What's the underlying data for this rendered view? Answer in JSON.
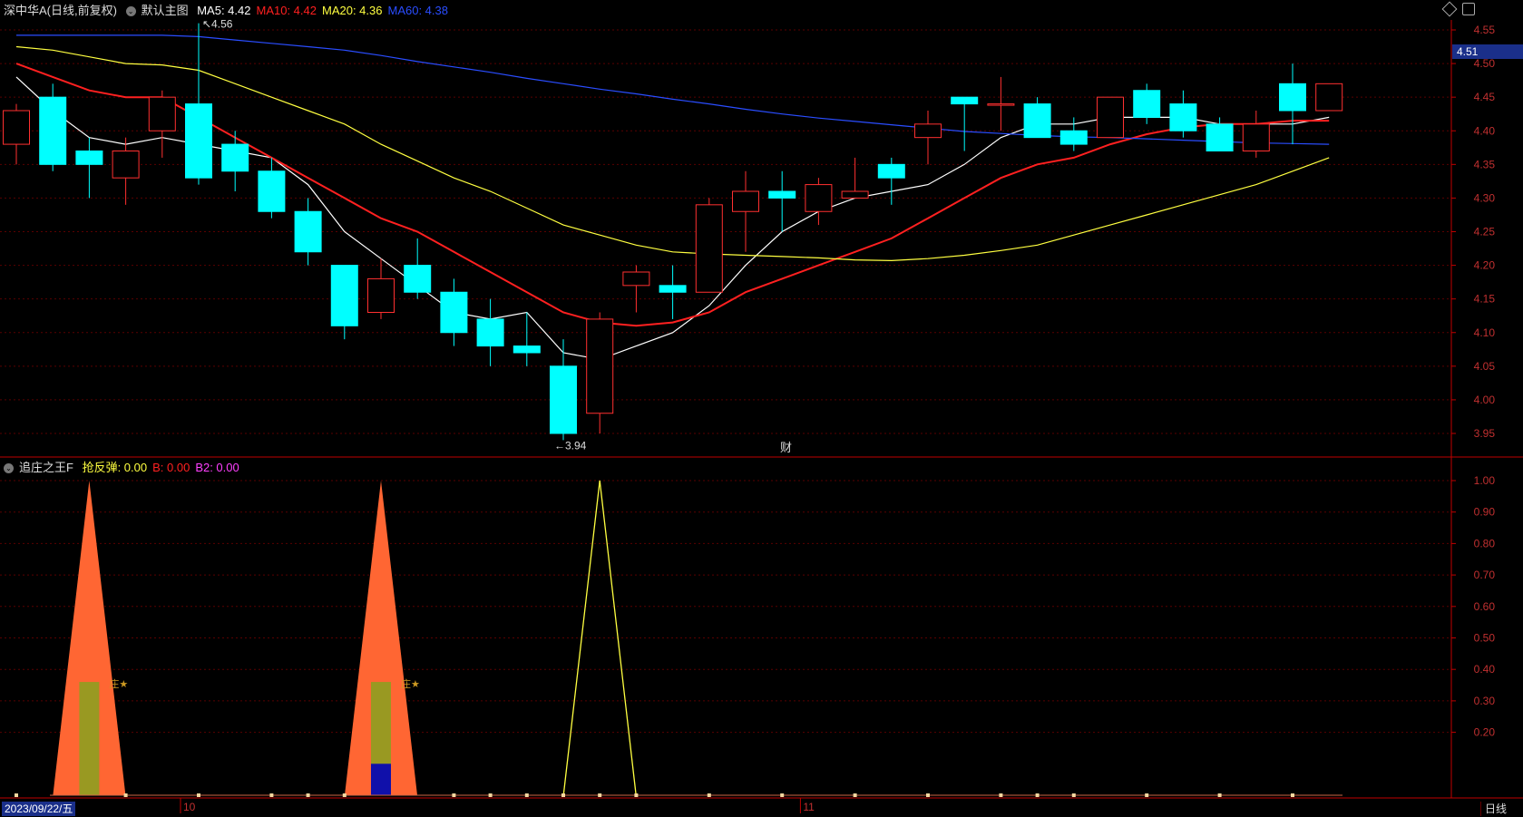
{
  "main_header": {
    "symbol": "深中华A",
    "mode": "(日线,前复权)",
    "template": "默认主图",
    "ma": [
      {
        "label": "MA5:",
        "value": "4.42",
        "color": "#ffffff"
      },
      {
        "label": "MA10:",
        "value": "4.42",
        "color": "#ff2020"
      },
      {
        "label": "MA20:",
        "value": "4.36",
        "color": "#ffff40"
      },
      {
        "label": "MA60:",
        "value": "4.38",
        "color": "#2a4dff"
      }
    ]
  },
  "indicator_header": {
    "name": "追庄之王F",
    "items": [
      {
        "label": "抢反弹:",
        "value": "0.00",
        "color": "#ffff40"
      },
      {
        "label": "B:",
        "value": "0.00",
        "color": "#ff2020"
      },
      {
        "label": "B2:",
        "value": "0.00",
        "color": "#ff40ff"
      }
    ]
  },
  "bottom_bar": {
    "date": "2023/09/22/五",
    "month_labels": [
      {
        "text": "10",
        "index": 5
      },
      {
        "text": "11",
        "index": 22
      }
    ],
    "period_button": "日线"
  },
  "annotations": {
    "high_label": "4.56",
    "low_label": "3.94",
    "finance_marker": "财",
    "current_price": "4.51",
    "star_label": "庄★"
  },
  "toolbar_icons": [
    "diamond-icon",
    "settings-icon"
  ],
  "colors": {
    "up": "#ff3030",
    "down": "#00ffff",
    "grid": "#5a0000",
    "axis": "#c00000",
    "orange_fill": "#ff6633",
    "olive_bar": "#999922",
    "blue_bar": "#1010aa",
    "yellow_line": "#ffff40"
  },
  "chart_data": [
    {
      "type": "candlestick",
      "y_ticks": [
        "4.55",
        "4.50",
        "4.45",
        "4.40",
        "4.35",
        "4.30",
        "4.25",
        "4.20",
        "4.15",
        "4.10",
        "4.05",
        "4.00",
        "3.95"
      ],
      "ylim": [
        3.92,
        4.57
      ],
      "candles": [
        {
          "o": 4.38,
          "h": 4.44,
          "l": 4.35,
          "c": 4.43
        },
        {
          "o": 4.45,
          "h": 4.47,
          "l": 4.34,
          "c": 4.35
        },
        {
          "o": 4.37,
          "h": 4.39,
          "l": 4.3,
          "c": 4.35
        },
        {
          "o": 4.33,
          "h": 4.39,
          "l": 4.29,
          "c": 4.37
        },
        {
          "o": 4.4,
          "h": 4.46,
          "l": 4.36,
          "c": 4.45
        },
        {
          "o": 4.44,
          "h": 4.56,
          "l": 4.32,
          "c": 4.33
        },
        {
          "o": 4.38,
          "h": 4.4,
          "l": 4.31,
          "c": 4.34
        },
        {
          "o": 4.34,
          "h": 4.36,
          "l": 4.27,
          "c": 4.28
        },
        {
          "o": 4.28,
          "h": 4.3,
          "l": 4.2,
          "c": 4.22
        },
        {
          "o": 4.2,
          "h": 4.2,
          "l": 4.09,
          "c": 4.11
        },
        {
          "o": 4.13,
          "h": 4.21,
          "l": 4.12,
          "c": 4.18
        },
        {
          "o": 4.2,
          "h": 4.24,
          "l": 4.15,
          "c": 4.16
        },
        {
          "o": 4.16,
          "h": 4.18,
          "l": 4.08,
          "c": 4.1
        },
        {
          "o": 4.12,
          "h": 4.15,
          "l": 4.05,
          "c": 4.08
        },
        {
          "o": 4.08,
          "h": 4.13,
          "l": 4.05,
          "c": 4.07
        },
        {
          "o": 4.05,
          "h": 4.09,
          "l": 3.94,
          "c": 3.95
        },
        {
          "o": 3.98,
          "h": 4.13,
          "l": 3.95,
          "c": 4.12
        },
        {
          "o": 4.17,
          "h": 4.2,
          "l": 4.13,
          "c": 4.19
        },
        {
          "o": 4.17,
          "h": 4.2,
          "l": 4.12,
          "c": 4.16
        },
        {
          "o": 4.16,
          "h": 4.3,
          "l": 4.16,
          "c": 4.29
        },
        {
          "o": 4.28,
          "h": 4.34,
          "l": 4.22,
          "c": 4.31
        },
        {
          "o": 4.31,
          "h": 4.34,
          "l": 4.25,
          "c": 4.3
        },
        {
          "o": 4.28,
          "h": 4.33,
          "l": 4.26,
          "c": 4.32
        },
        {
          "o": 4.3,
          "h": 4.36,
          "l": 4.3,
          "c": 4.31
        },
        {
          "o": 4.35,
          "h": 4.36,
          "l": 4.29,
          "c": 4.33
        },
        {
          "o": 4.39,
          "h": 4.43,
          "l": 4.35,
          "c": 4.41
        },
        {
          "o": 4.45,
          "h": 4.45,
          "l": 4.37,
          "c": 4.44
        },
        {
          "o": 4.44,
          "h": 4.48,
          "l": 4.4,
          "c": 4.44
        },
        {
          "o": 4.44,
          "h": 4.45,
          "l": 4.39,
          "c": 4.39
        },
        {
          "o": 4.4,
          "h": 4.42,
          "l": 4.37,
          "c": 4.38
        },
        {
          "o": 4.39,
          "h": 4.45,
          "l": 4.39,
          "c": 4.45
        },
        {
          "o": 4.46,
          "h": 4.47,
          "l": 4.41,
          "c": 4.42
        },
        {
          "o": 4.44,
          "h": 4.46,
          "l": 4.39,
          "c": 4.4
        },
        {
          "o": 4.41,
          "h": 4.42,
          "l": 4.37,
          "c": 4.37
        },
        {
          "o": 4.37,
          "h": 4.43,
          "l": 4.36,
          "c": 4.41
        },
        {
          "o": 4.47,
          "h": 4.5,
          "l": 4.38,
          "c": 4.43
        },
        {
          "o": 4.43,
          "h": 4.47,
          "l": 4.43,
          "c": 4.47
        }
      ],
      "series": [
        {
          "name": "MA5",
          "color": "#ffffff",
          "values": [
            4.48,
            4.43,
            4.39,
            4.38,
            4.39,
            4.38,
            4.37,
            4.36,
            4.32,
            4.25,
            4.21,
            4.17,
            4.13,
            4.12,
            4.13,
            4.07,
            4.06,
            4.08,
            4.1,
            4.14,
            4.2,
            4.25,
            4.28,
            4.3,
            4.31,
            4.32,
            4.35,
            4.39,
            4.41,
            4.41,
            4.42,
            4.42,
            4.42,
            4.41,
            4.41,
            4.41,
            4.42
          ]
        },
        {
          "name": "MA10",
          "color": "#ff2020",
          "values": [
            4.5,
            4.48,
            4.46,
            4.45,
            4.45,
            4.42,
            4.39,
            4.36,
            4.33,
            4.3,
            4.27,
            4.25,
            4.22,
            4.19,
            4.16,
            4.13,
            4.115,
            4.11,
            4.115,
            4.13,
            4.16,
            4.18,
            4.2,
            4.22,
            4.24,
            4.27,
            4.3,
            4.33,
            4.35,
            4.36,
            4.38,
            4.395,
            4.405,
            4.41,
            4.41,
            4.415,
            4.415
          ]
        },
        {
          "name": "MA20",
          "color": "#ffff40",
          "values": [
            4.525,
            4.52,
            4.51,
            4.5,
            4.498,
            4.49,
            4.47,
            4.45,
            4.43,
            4.41,
            4.38,
            4.355,
            4.33,
            4.31,
            4.285,
            4.26,
            4.245,
            4.23,
            4.22,
            4.217,
            4.215,
            4.213,
            4.211,
            4.208,
            4.207,
            4.21,
            4.215,
            4.222,
            4.23,
            4.245,
            4.26,
            4.275,
            4.29,
            4.305,
            4.32,
            4.34,
            4.36
          ]
        },
        {
          "name": "MA60",
          "color": "#2a4dff",
          "values": [
            4.542,
            4.542,
            4.542,
            4.542,
            4.542,
            4.54,
            4.535,
            4.53,
            4.525,
            4.52,
            4.512,
            4.503,
            4.495,
            4.487,
            4.478,
            4.47,
            4.462,
            4.455,
            4.447,
            4.44,
            4.432,
            4.425,
            4.419,
            4.414,
            4.409,
            4.404,
            4.399,
            4.396,
            4.393,
            4.391,
            4.39,
            4.388,
            4.386,
            4.384,
            4.382,
            4.381,
            4.38
          ]
        }
      ]
    },
    {
      "type": "indicator",
      "name": "追庄之王F",
      "y_ticks": [
        "1.00",
        "0.90",
        "0.80",
        "0.70",
        "0.60",
        "0.50",
        "0.40",
        "0.30",
        "0.20"
      ],
      "ylim": [
        0,
        1.0
      ],
      "spikes": [
        {
          "kind": "orange_triangle",
          "index": 2,
          "value": 1.0
        },
        {
          "kind": "orange_triangle",
          "index": 10,
          "value": 1.0
        },
        {
          "kind": "yellow_line",
          "index": 16,
          "value": 1.0
        }
      ],
      "bars": [
        {
          "kind": "olive",
          "index": 2,
          "value": 0.36
        },
        {
          "kind": "olive",
          "index": 10,
          "value": 0.36
        },
        {
          "kind": "blue",
          "index": 10,
          "value": 0.1
        }
      ],
      "markers": [
        0,
        3,
        5,
        7,
        8,
        9,
        12,
        13,
        14,
        15,
        16,
        17,
        19,
        21,
        23,
        25,
        27,
        28,
        29,
        31,
        33,
        35
      ]
    }
  ]
}
